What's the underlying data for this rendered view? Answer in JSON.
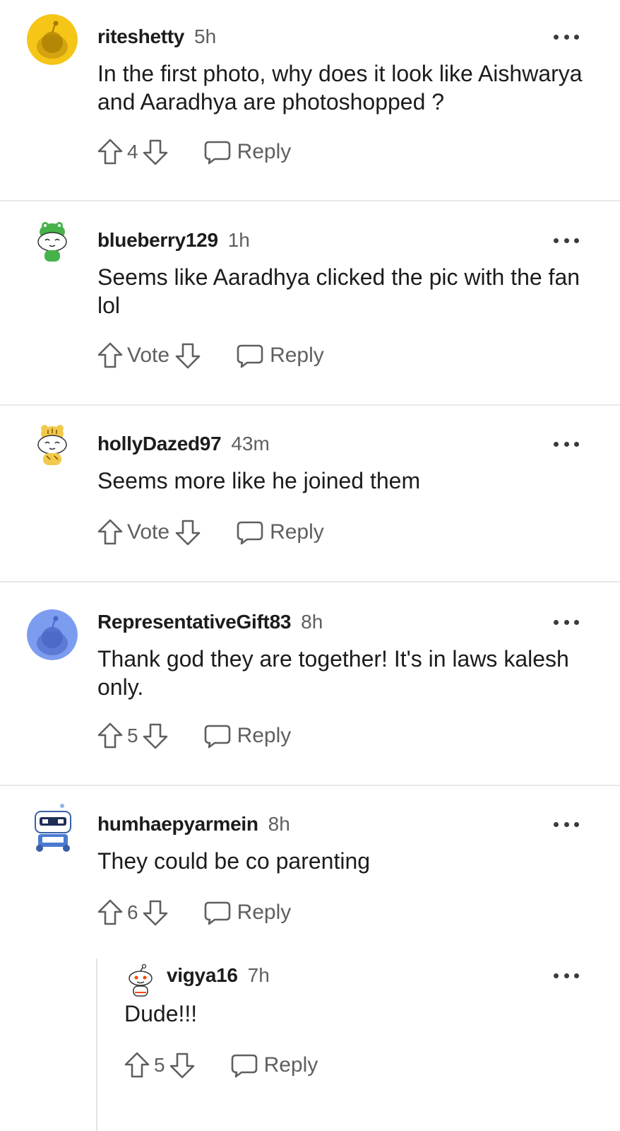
{
  "comments": [
    {
      "username": "riteshetty",
      "time": "5h",
      "text": "In the first photo, why does it look like Aishwarya and Aaradhya are photoshopped ?",
      "score": "4",
      "reply_label": "Reply",
      "avatar_color": "#f5c518"
    },
    {
      "username": "blueberry129",
      "time": "1h",
      "text": "Seems like Aaradhya clicked the pic with the fan lol",
      "score": "Vote",
      "reply_label": "Reply",
      "avatar_color": "#46b34a"
    },
    {
      "username": "hollyDazed97",
      "time": "43m",
      "text": "Seems more like he joined them",
      "score": "Vote",
      "reply_label": "Reply",
      "avatar_color": "#f2c94c"
    },
    {
      "username": "RepresentativeGift83",
      "time": "8h",
      "text": "Thank god they are together! It's in laws kalesh only.",
      "score": "5",
      "reply_label": "Reply",
      "avatar_color": "#7c9cf0"
    },
    {
      "username": "humhaepyarmein",
      "time": "8h",
      "text": "They could be co parenting",
      "score": "6",
      "reply_label": "Reply",
      "avatar_color": "#4a7bd1"
    }
  ],
  "reply_comment": {
    "username": "vigya16",
    "time": "7h",
    "text": "Dude!!!",
    "score": "5",
    "reply_label": "Reply"
  },
  "colors": {
    "text": "#1c1c1c",
    "muted": "#5f5f5f",
    "divider": "#e9e9e9"
  }
}
